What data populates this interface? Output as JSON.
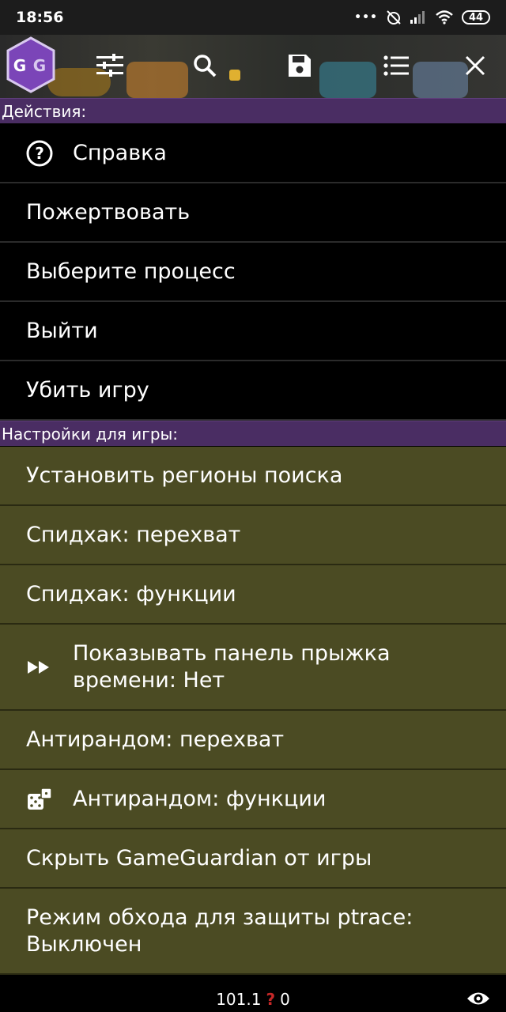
{
  "status": {
    "time": "18:56",
    "battery": "44"
  },
  "actions_header": "Действия:",
  "actions": [
    {
      "label": "Справка",
      "icon": "help-circle-icon"
    },
    {
      "label": "Пожертвовать"
    },
    {
      "label": "Выберите процесс"
    },
    {
      "label": "Выйти"
    },
    {
      "label": "Убить игру"
    }
  ],
  "game_header": "Настройки для игры:",
  "game_settings": [
    {
      "label": "Установить регионы поиска"
    },
    {
      "label": "Спидхак: перехват"
    },
    {
      "label": "Спидхак: функции"
    },
    {
      "label": "Показывать панель прыжка времени: Нет",
      "icon": "fast-forward-icon"
    },
    {
      "label": "Антирандом: перехват"
    },
    {
      "label": "Антирандом: функции",
      "icon": "dice-icon"
    },
    {
      "label": "Скрыть GameGuardian от игры"
    },
    {
      "label": "Режим обхода для защиты ptrace: Выключен"
    }
  ],
  "bottom": {
    "left_value": "101.1",
    "mark": "?",
    "right_value": "0"
  },
  "colors": {
    "accent_header": "#4a2d63",
    "olive_bg": "#4b4b23",
    "logo_purple": "#7b45b8"
  }
}
